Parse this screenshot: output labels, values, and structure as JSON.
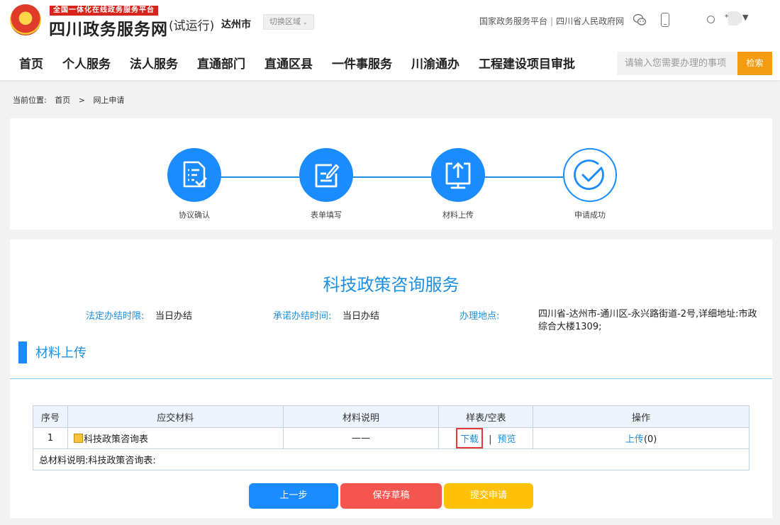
{
  "header": {
    "slogan": "全国一体化在线政务服务平台",
    "site_title": "四川政务服务网",
    "trial": "(试运行)",
    "city": "达州市",
    "region_switch": "切换区域",
    "links": [
      "国家政务服务平台",
      "四川省人民政府网"
    ],
    "link_sep": "|",
    "user_name": "*",
    "user_caret": "▼"
  },
  "nav": {
    "items": [
      "首页",
      "个人服务",
      "法人服务",
      "直通部门",
      "直通区县",
      "一件事服务",
      "川渝通办",
      "工程建设项目审批"
    ],
    "search_placeholder": "请输入您需要办理的事项",
    "search_button": "检索"
  },
  "breadcrumb": {
    "label": "当前位置:",
    "items": [
      "首页",
      ">",
      "网上申请"
    ]
  },
  "steps": [
    "协议确认",
    "表单填写",
    "材料上传",
    "申请成功"
  ],
  "service": {
    "title": "科技政策咨询服务",
    "limit_label": "法定办结时限:",
    "limit_value": "当日办结",
    "promise_label": "承诺办结时间:",
    "promise_value": "当日办结",
    "place_label": "办理地点:",
    "place_value": "四川省-达州市-通川区-永兴路街道-2号,详细地址:市政综合大楼1309;"
  },
  "section": {
    "title": "材料上传"
  },
  "table": {
    "headers": [
      "序号",
      "应交材料",
      "材料说明",
      "样表/空表",
      "操作"
    ],
    "row": {
      "index": "1",
      "material": "科技政策咨询表",
      "desc": "——",
      "download": "下载",
      "sep": "|",
      "preview": "预览",
      "upload": "上传",
      "upload_count": "(0)"
    },
    "summary": "总材料说明:科技政策咨询表:"
  },
  "buttons": {
    "prev": "上一步",
    "save": "保存草稿",
    "submit": "提交申请"
  },
  "colors": {
    "primary": "#1a8cff",
    "title_blue": "#1e8fe1",
    "save_red": "#f5554f",
    "submit_yellow": "#ffc107",
    "search_orange": "#f39c12"
  }
}
